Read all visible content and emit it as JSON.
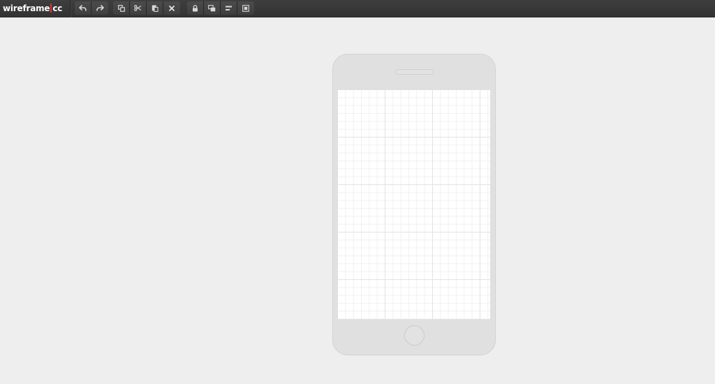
{
  "app": {
    "logo_left": "wireframe",
    "logo_right": "cc",
    "logo_separator_color": "#e0382f"
  },
  "toolbar": {
    "groups": [
      {
        "name": "history",
        "buttons": [
          {
            "name": "undo",
            "icon": "undo-icon"
          },
          {
            "name": "redo",
            "icon": "redo-icon"
          }
        ]
      },
      {
        "name": "clipboard",
        "buttons": [
          {
            "name": "duplicate",
            "icon": "duplicate-icon"
          },
          {
            "name": "cut",
            "icon": "scissors-icon"
          },
          {
            "name": "paste",
            "icon": "paste-icon"
          },
          {
            "name": "delete",
            "icon": "close-icon"
          }
        ]
      },
      {
        "name": "arrange",
        "buttons": [
          {
            "name": "lock",
            "icon": "lock-icon"
          },
          {
            "name": "bring-front",
            "icon": "layers-icon"
          },
          {
            "name": "align",
            "icon": "align-left-icon"
          },
          {
            "name": "group",
            "icon": "group-icon"
          }
        ]
      }
    ],
    "icon_color": "#d8d8d8"
  },
  "canvas": {
    "device": "mobile-phone",
    "background_color": "#eeeeee",
    "screen_color": "#ffffff",
    "grid": true
  }
}
